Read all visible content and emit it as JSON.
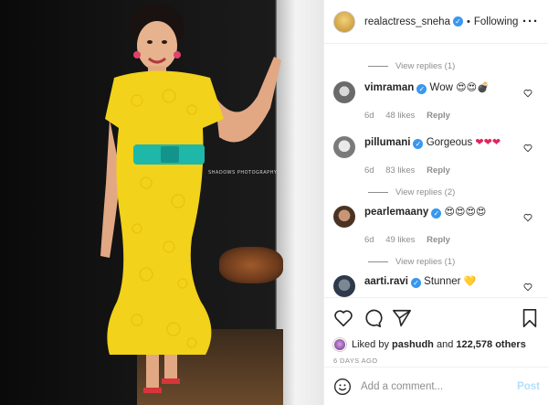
{
  "post": {
    "author": "realactress_sneha",
    "follow_status": "Following",
    "more_icon": "more-horizontal-icon",
    "watermark": "SHADOWS PHOTOGRAPHY"
  },
  "comments": [
    {
      "replies": "View replies (1)"
    },
    {
      "username": "vimraman",
      "text": "Wow",
      "emojis": "😍😍💣",
      "age": "6d",
      "likes": "48 likes",
      "reply": "Reply"
    },
    {
      "username": "pillumani",
      "text": "Gorgeous",
      "emojis": "❤❤❤",
      "age": "6d",
      "likes": "83 likes",
      "reply": "Reply"
    },
    {
      "replies": "View replies (2)"
    },
    {
      "username": "pearlemaany",
      "text": "",
      "emojis": "😍😍😍😍",
      "age": "6d",
      "likes": "49 likes",
      "reply": "Reply"
    },
    {
      "replies": "View replies (1)"
    },
    {
      "username": "aarti.ravi",
      "text": "Stunner",
      "emojis": "💛"
    }
  ],
  "actions": {
    "liked_prefix": "Liked by",
    "liked_user": "pashudh",
    "liked_and": "and",
    "liked_count": "122,578 others",
    "timestamp": "6 DAYS AGO"
  },
  "add_comment": {
    "placeholder": "Add a comment...",
    "post_label": "Post"
  },
  "colors": {
    "accent": "#3897f0",
    "post_disabled": "#b2dffc",
    "dress": "#f2d21a",
    "belt": "#1fb8a8"
  }
}
